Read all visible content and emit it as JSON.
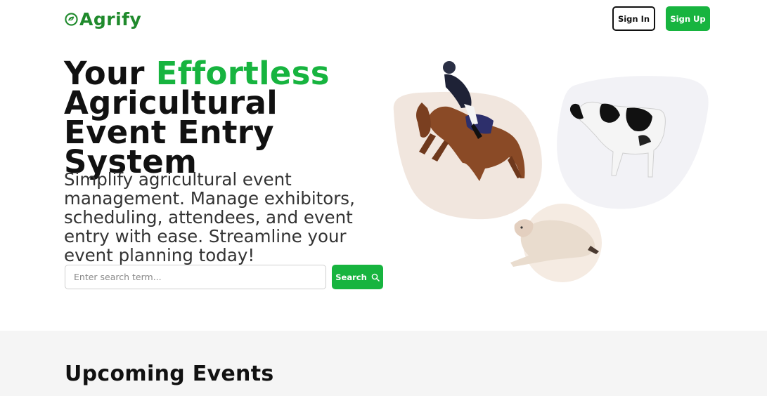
{
  "header": {
    "logo_text": "Agrify",
    "logo_icon": "leaf-circle-icon",
    "sign_in_label": "Sign In",
    "sign_up_label": "Sign Up"
  },
  "hero": {
    "title_part1": "Your ",
    "title_accent": "Effortless",
    "title_part2": "Agricultural Event Entry System",
    "subtitle": "Simplify agricultural event management. Manage exhibitors, scheduling, attendees, and event entry with ease. Streamline your event planning today!",
    "search": {
      "placeholder": "Enter search term...",
      "value": "",
      "button_label": "Search",
      "button_icon": "search-icon"
    }
  },
  "upcoming": {
    "title": "Upcoming Events"
  },
  "colors": {
    "accent": "#17b43f",
    "logo": "#1f8a2c",
    "blob_tan": "#f1e6de",
    "blob_grey": "#f2f2f6",
    "section_bg": "#f5f5f5"
  }
}
